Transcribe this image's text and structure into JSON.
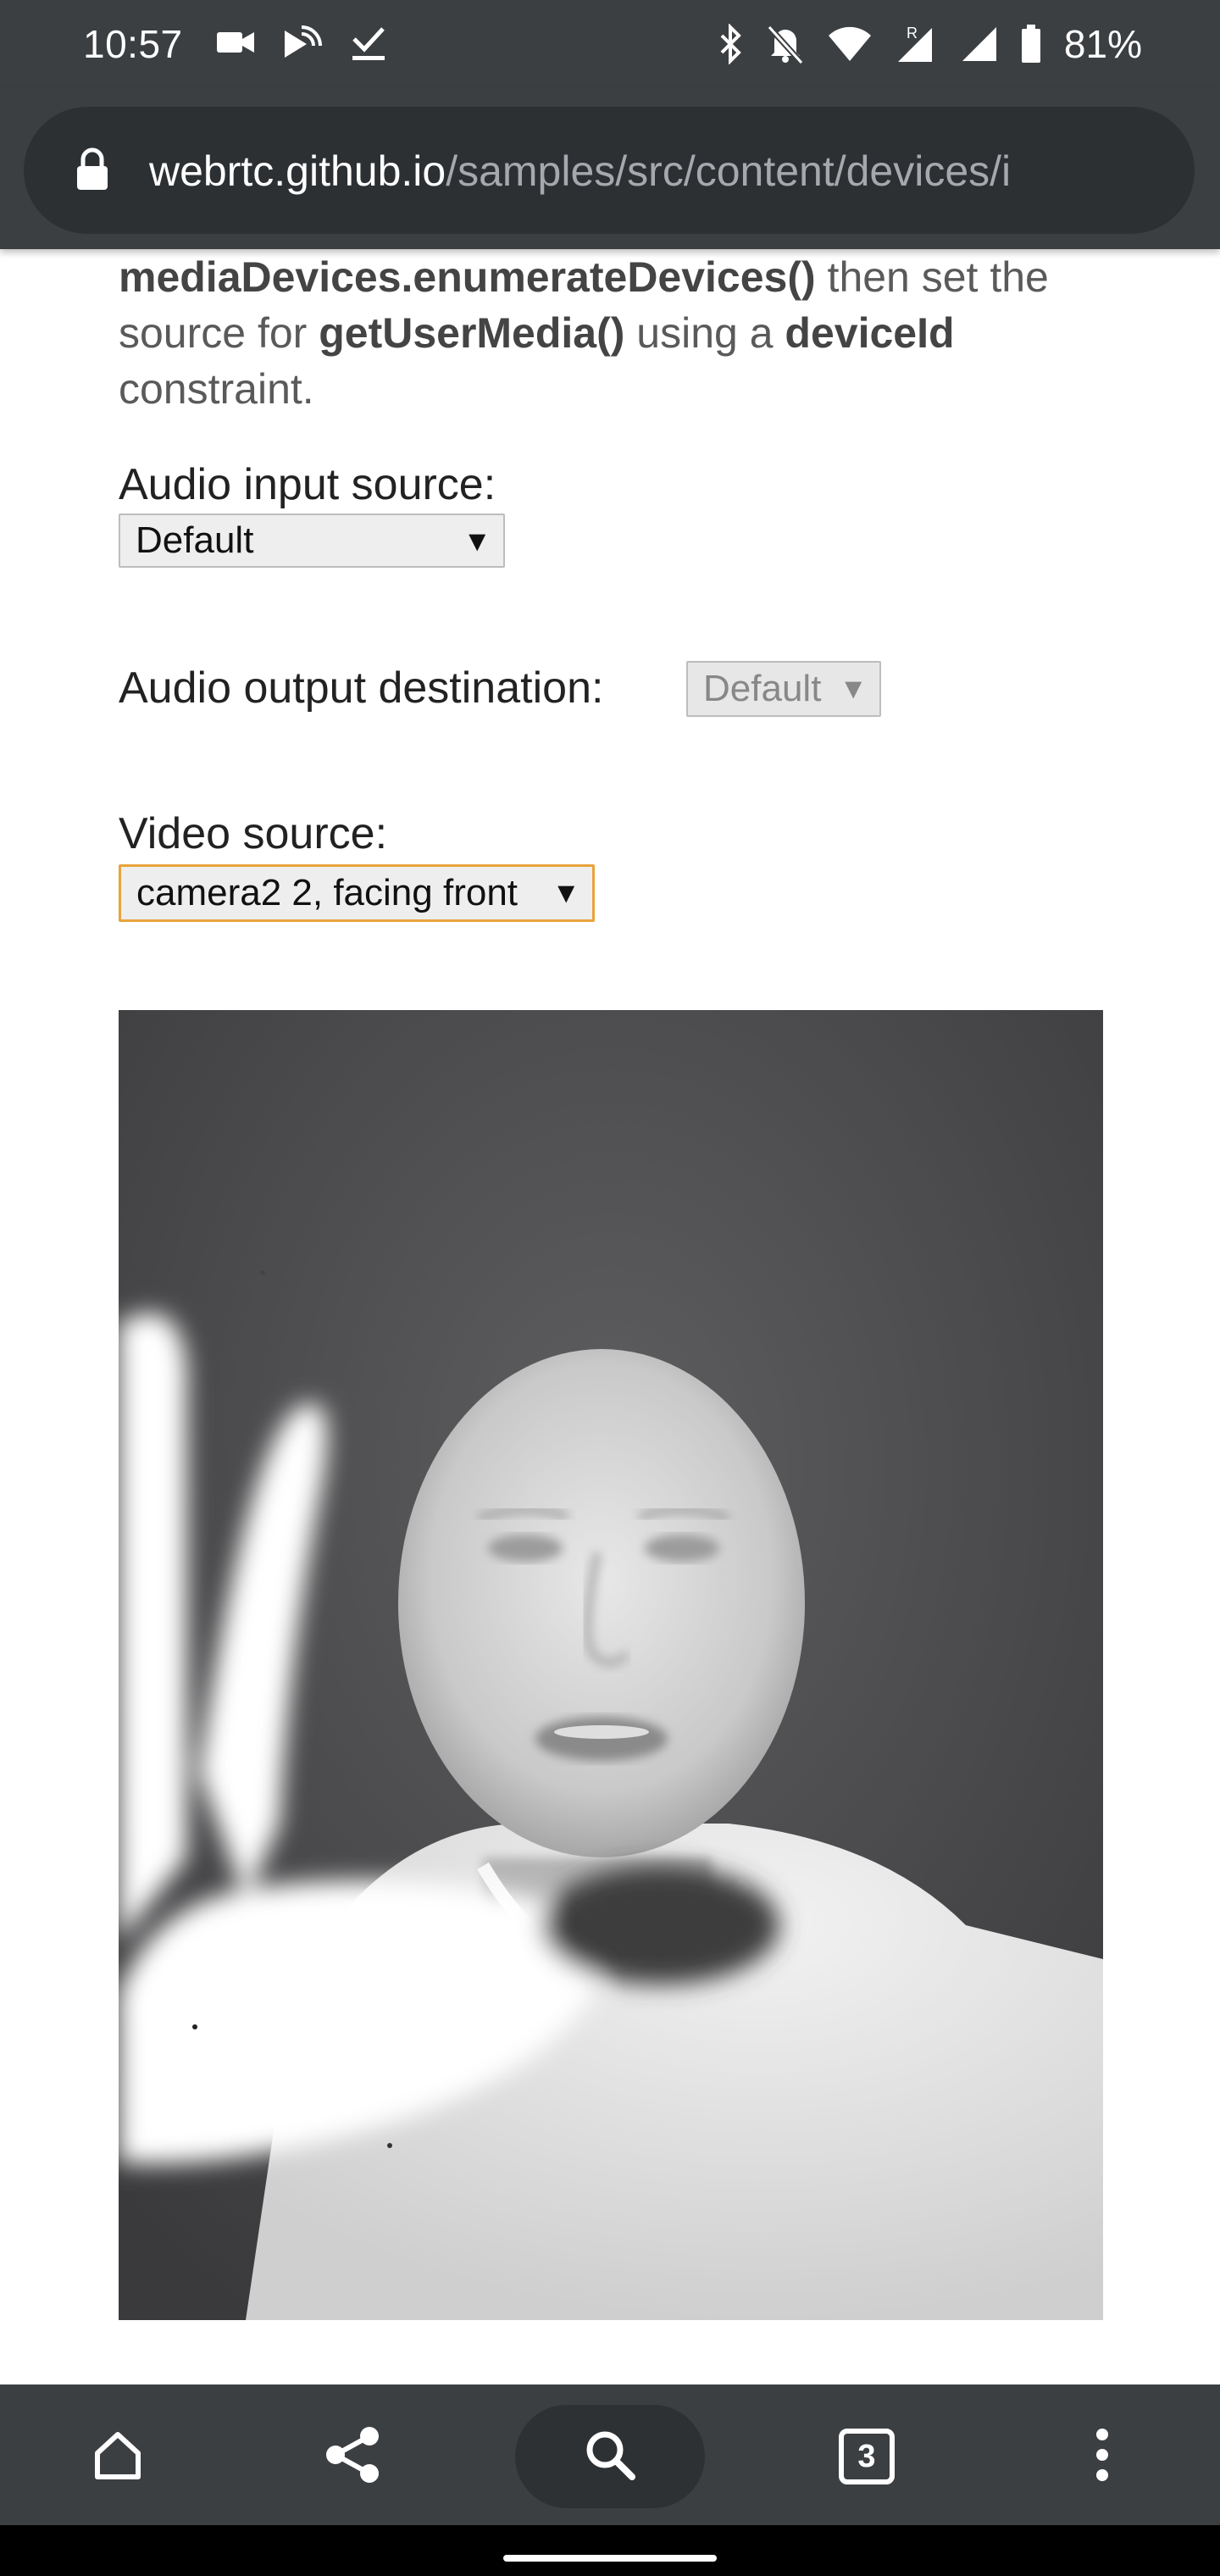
{
  "status_bar": {
    "time": "10:57",
    "battery_percent": "81%",
    "left_icons": [
      "video-call-icon",
      "cast-icon",
      "download-done-icon"
    ],
    "right_icons": [
      "bluetooth-icon",
      "bell-off-icon",
      "wifi-icon",
      "signal-roaming-icon",
      "signal-icon",
      "battery-icon"
    ]
  },
  "browser": {
    "url_domain": "webrtc.github.io",
    "url_path": "/samples/src/content/devices/i"
  },
  "page": {
    "intro_code_1": "mediaDevices.enumerateDevices()",
    "intro_text_1": " then set the source for ",
    "intro_code_2": "getUserMedia()",
    "intro_text_2": " using a ",
    "intro_code_3": "deviceId",
    "intro_text_3": " constraint.",
    "audio_input": {
      "label": "Audio input source:",
      "selected": "Default"
    },
    "audio_output": {
      "label": "Audio output destination:",
      "selected": "Default"
    },
    "video_source": {
      "label": "Video source:",
      "selected": "camera2 2, facing front"
    }
  },
  "toolbar": {
    "buttons": [
      "home-icon",
      "share-icon",
      "search-icon",
      "tab-switcher",
      "more-icon"
    ],
    "tab_count": "3"
  }
}
